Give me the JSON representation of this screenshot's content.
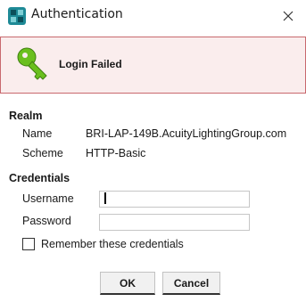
{
  "window": {
    "title": "Authentication",
    "icon": "app-logo-icon",
    "close_icon": "close-icon"
  },
  "banner": {
    "icon": "key-icon",
    "message": "Login Failed",
    "background": "#faeded",
    "border": "#c8696e"
  },
  "realm": {
    "heading": "Realm",
    "name_label": "Name",
    "name_value": "BRI-LAP-149B.AcuityLightingGroup.com",
    "scheme_label": "Scheme",
    "scheme_value": "HTTP-Basic"
  },
  "credentials": {
    "heading": "Credentials",
    "username_label": "Username",
    "username_value": "",
    "password_label": "Password",
    "password_value": "",
    "remember_label": "Remember these credentials",
    "remember_checked": false
  },
  "buttons": {
    "ok_label": "OK",
    "cancel_label": "Cancel"
  },
  "colors": {
    "key_green": "#6abf1e",
    "app_icon_teal": "#1e8a96"
  }
}
